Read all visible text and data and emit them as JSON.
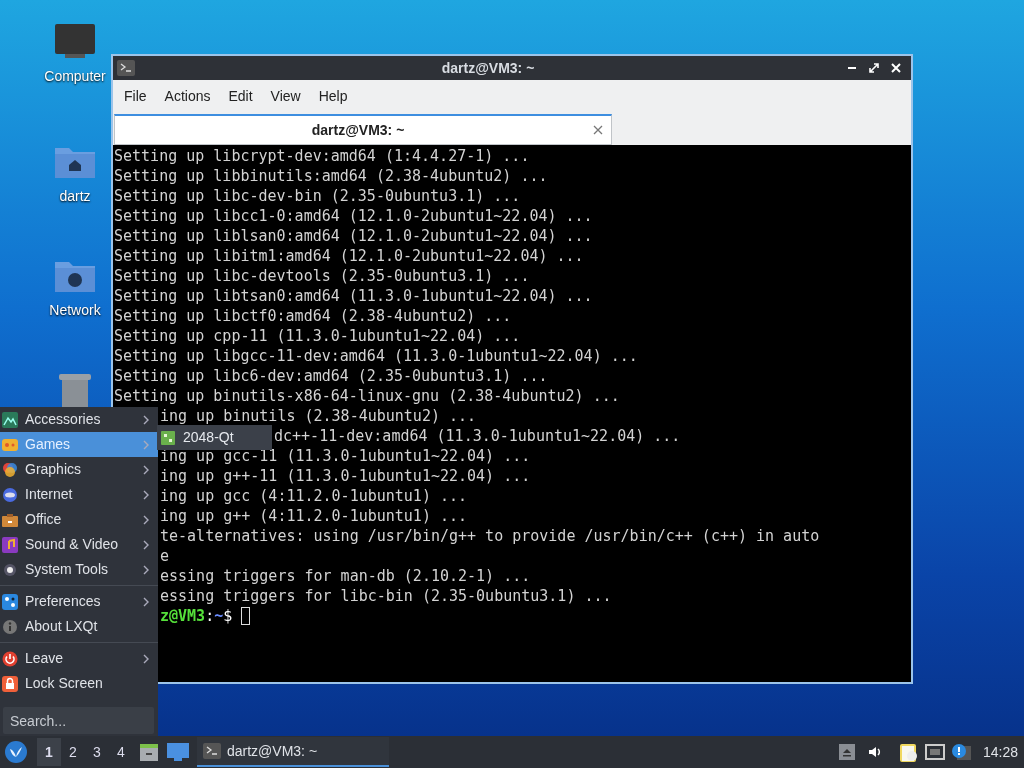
{
  "desktop_icons": [
    {
      "label": "Computer",
      "kind": "computer"
    },
    {
      "label": "dartz",
      "kind": "home"
    },
    {
      "label": "Network",
      "kind": "network"
    },
    {
      "kind": "trash"
    }
  ],
  "terminal": {
    "title": "dartz@VM3: ~",
    "menu": [
      "File",
      "Actions",
      "Edit",
      "View",
      "Help"
    ],
    "tabs": [
      {
        "label": "dartz@VM3: ~",
        "selected": true
      }
    ],
    "lines": [
      {
        "text": "Setting up libcrypt-dev:amd64 (1:4.4.27-1) ...",
        "kind": "full"
      },
      {
        "text": "Setting up libbinutils:amd64 (2.38-4ubuntu2) ...",
        "kind": "full"
      },
      {
        "text": "Setting up libc-dev-bin (2.35-0ubuntu3.1) ...",
        "kind": "full"
      },
      {
        "text": "Setting up libcc1-0:amd64 (12.1.0-2ubuntu1~22.04) ...",
        "kind": "full"
      },
      {
        "text": "Setting up liblsan0:amd64 (12.1.0-2ubuntu1~22.04) ...",
        "kind": "full"
      },
      {
        "text": "Setting up libitm1:amd64 (12.1.0-2ubuntu1~22.04) ...",
        "kind": "full"
      },
      {
        "text": "Setting up libc-devtools (2.35-0ubuntu3.1) ...",
        "kind": "full"
      },
      {
        "text": "Setting up libtsan0:amd64 (11.3.0-1ubuntu1~22.04) ...",
        "kind": "full"
      },
      {
        "text": "Setting up libctf0:amd64 (2.38-4ubuntu2) ...",
        "kind": "full"
      },
      {
        "text": "Setting up cpp-11 (11.3.0-1ubuntu1~22.04) ...",
        "kind": "full"
      },
      {
        "text": "Setting up libgcc-11-dev:amd64 (11.3.0-1ubuntu1~22.04) ...",
        "kind": "full"
      },
      {
        "text": "Setting up libc6-dev:amd64 (2.35-0ubuntu3.1) ...",
        "kind": "full"
      },
      {
        "text": "Setting up binutils-x86-64-linux-gnu (2.38-4ubuntu2) ...",
        "kind": "full"
      },
      {
        "text": "ing up binutils (2.38-4ubuntu2) ...",
        "kind": "behind-menu"
      },
      {
        "text": "dc++-11-dev:amd64 (11.3.0-1ubuntu1~22.04) ...",
        "kind": "behind-submenu"
      },
      {
        "text": "ing up gcc-11 (11.3.0-1ubuntu1~22.04) ...",
        "kind": "behind-menu"
      },
      {
        "text": "ing up g++-11 (11.3.0-1ubuntu1~22.04) ...",
        "kind": "behind-menu"
      },
      {
        "text": "ing up gcc (4:11.2.0-1ubuntu1) ...",
        "kind": "behind-menu"
      },
      {
        "text": "ing up g++ (4:11.2.0-1ubuntu1) ...",
        "kind": "behind-menu"
      },
      {
        "text": "te-alternatives: using /usr/bin/g++ to provide /usr/bin/c++ (c++) in auto",
        "kind": "behind-menu"
      },
      {
        "text": "e",
        "kind": "behind-menu"
      },
      {
        "text": "essing triggers for man-db (2.10.2-1) ...",
        "kind": "behind-menu"
      },
      {
        "text": "essing triggers for libc-bin (2.35-0ubuntu3.1) ...",
        "kind": "behind-menu"
      }
    ],
    "prompt": {
      "user": "z@VM3",
      "separator": ":",
      "path": "~",
      "symbol": "$"
    }
  },
  "start_menu": {
    "sections": [
      [
        {
          "label": "Accessories",
          "kind": "accessories",
          "submenu": true,
          "selected": false
        },
        {
          "label": "Games",
          "kind": "games",
          "submenu": true,
          "selected": true
        },
        {
          "label": "Graphics",
          "kind": "graphics",
          "submenu": true,
          "selected": false
        },
        {
          "label": "Internet",
          "kind": "internet",
          "submenu": true,
          "selected": false
        },
        {
          "label": "Office",
          "kind": "office",
          "submenu": true,
          "selected": false
        },
        {
          "label": "Sound & Video",
          "kind": "media",
          "submenu": true,
          "selected": false
        },
        {
          "label": "System Tools",
          "kind": "system",
          "submenu": true,
          "selected": false
        }
      ],
      [
        {
          "label": "Preferences",
          "kind": "preferences",
          "submenu": true,
          "selected": false
        },
        {
          "label": "About LXQt",
          "kind": "about",
          "submenu": false,
          "selected": false
        }
      ],
      [
        {
          "label": "Leave",
          "kind": "leave",
          "submenu": true,
          "selected": false
        },
        {
          "label": "Lock Screen",
          "kind": "lock",
          "submenu": false,
          "selected": false
        }
      ]
    ],
    "search": {
      "placeholder": "Search..."
    },
    "submenu": [
      {
        "label": "2048-Qt"
      }
    ]
  },
  "taskbar": {
    "workspaces": [
      {
        "label": "1",
        "selected": true
      },
      {
        "label": "2",
        "selected": false
      },
      {
        "label": "3",
        "selected": false
      },
      {
        "label": "4",
        "selected": false
      }
    ],
    "tasks": [
      {
        "label": "dartz@VM3: ~",
        "selected": true
      }
    ],
    "clock": "14:28"
  }
}
